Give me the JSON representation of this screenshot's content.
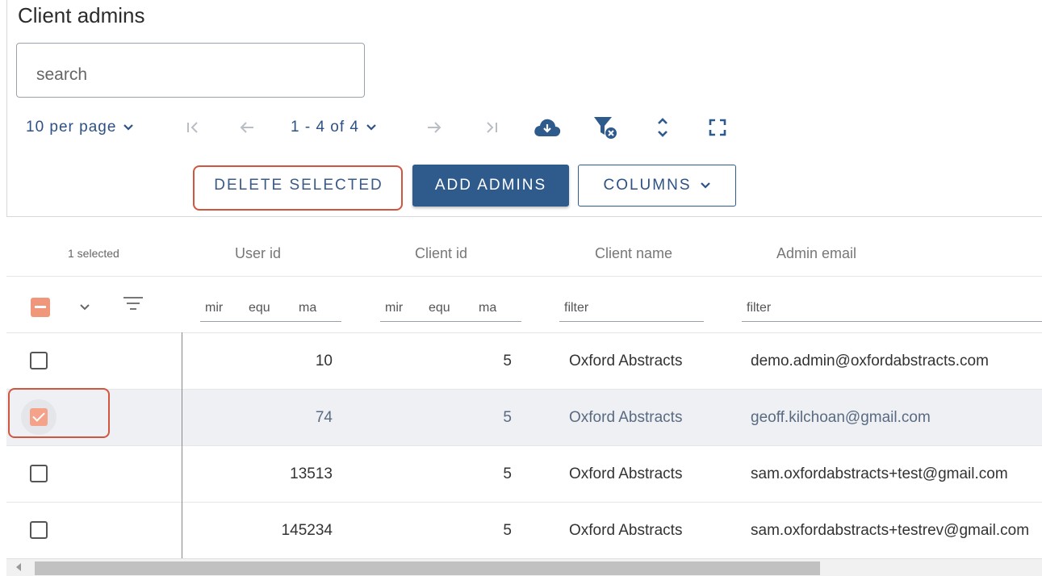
{
  "page": {
    "title": "Client admins"
  },
  "search": {
    "placeholder": "search"
  },
  "pager": {
    "per_page_label": "10 per page",
    "range_label": "1 - 4 of 4"
  },
  "icons": {
    "first": "first-page-icon",
    "prev": "prev-page-icon",
    "next": "next-page-icon",
    "last": "last-page-icon",
    "download": "cloud-download-icon",
    "clear_filter": "filter-clear-icon",
    "expand": "expand-rows-icon",
    "fullscreen": "fullscreen-icon"
  },
  "actions": {
    "delete_label": "DELETE SELECTED",
    "add_label": "ADD ADMINS",
    "columns_label": "COLUMNS"
  },
  "colors": {
    "accent": "#2f5a8c",
    "highlight": "#d2553f",
    "checkbox": "#f4a28a"
  },
  "table": {
    "selected_label": "1 selected",
    "headers": {
      "user_id": "User id",
      "client_id": "Client id",
      "client_name": "Client name",
      "admin_email": "Admin email"
    },
    "filters": {
      "min": "mir",
      "eq": "equ",
      "max": "ma",
      "text": "filter"
    },
    "rows": [
      {
        "user_id": "10",
        "client_id": "5",
        "client_name": "Oxford Abstracts",
        "admin_email": "demo.admin@oxfordabstracts.com",
        "selected": false
      },
      {
        "user_id": "74",
        "client_id": "5",
        "client_name": "Oxford Abstracts",
        "admin_email": "geoff.kilchoan@gmail.com",
        "selected": true
      },
      {
        "user_id": "13513",
        "client_id": "5",
        "client_name": "Oxford Abstracts",
        "admin_email": "sam.oxfordabstracts+test@gmail.com",
        "selected": false
      },
      {
        "user_id": "145234",
        "client_id": "5",
        "client_name": "Oxford Abstracts",
        "admin_email": "sam.oxfordabstracts+testrev@gmail.com",
        "selected": false
      }
    ]
  }
}
